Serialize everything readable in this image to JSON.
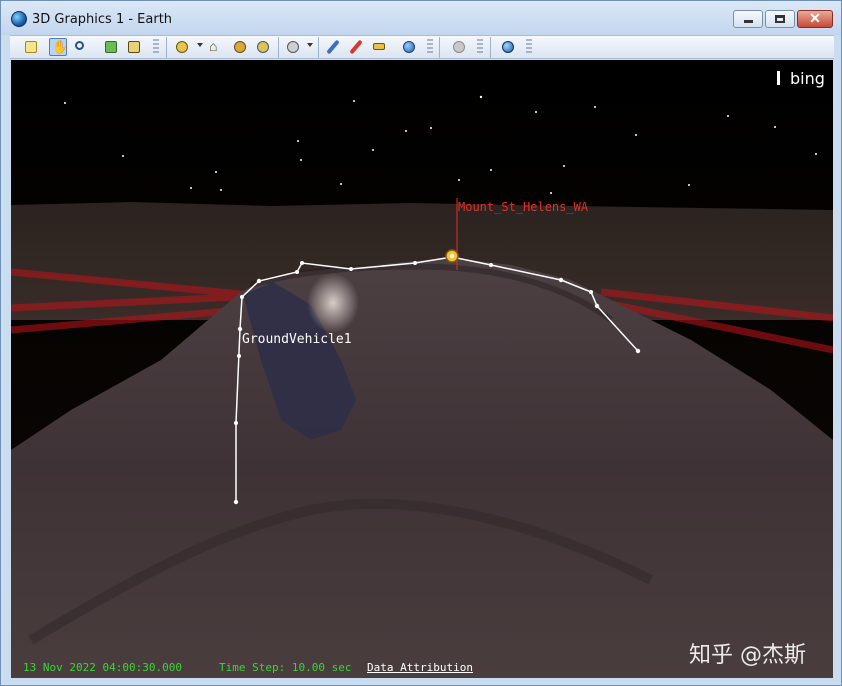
{
  "window": {
    "title": "3D Graphics 1 - Earth",
    "controls": {
      "minimize": "minimize-icon",
      "maximize": "maximize-icon",
      "close": "close-icon"
    }
  },
  "toolbar": {
    "groups": [
      {
        "buttons": [
          "properties-icon",
          "pan-hand-icon",
          "zoom-icon",
          "view-from-icon",
          "snapshot-icon"
        ]
      },
      {
        "buttons": [
          "view-eye-icon",
          "home-icon",
          "view-object-icon",
          "view-top-icon"
        ]
      },
      {
        "buttons": [
          "orbit-view-icon"
        ]
      },
      {
        "buttons": [
          "pencil-icon",
          "marker-icon",
          "ruler-icon",
          "globe-settings-icon"
        ]
      },
      {
        "buttons": [
          "terrain-disabled-icon"
        ]
      },
      {
        "buttons": [
          "globe-imagery-icon"
        ]
      }
    ]
  },
  "scene": {
    "logo": "bing",
    "labels": {
      "vehicle": "GroundVehicle1",
      "place": "Mount_St_Helens_WA"
    },
    "colors": {
      "place_label": "#e0302a",
      "route": "#ffffff",
      "sensor_lines": "#c0141a",
      "status_green": "#39d639"
    }
  },
  "status": {
    "time": "13 Nov 2022 04:00:30.000",
    "step": "Time Step: 10.00 sec",
    "attribution": "Data Attribution"
  },
  "watermark": "知乎 @杰斯"
}
